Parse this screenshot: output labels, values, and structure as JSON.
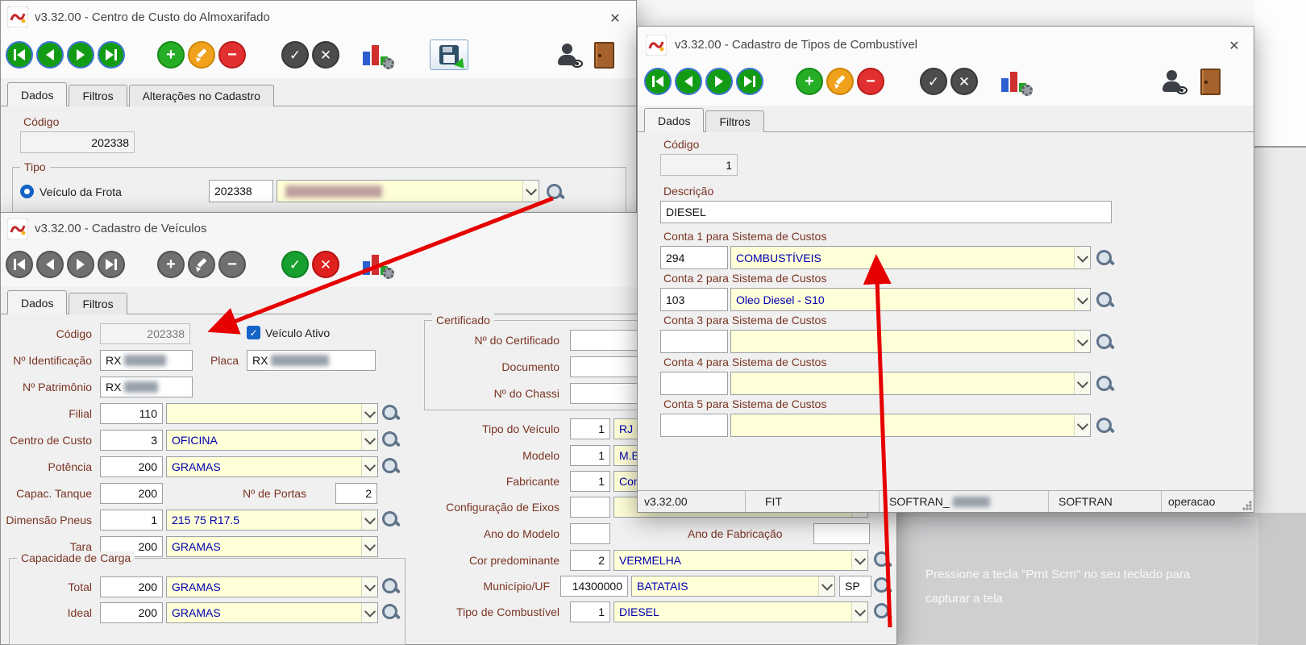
{
  "window_almoxarifado": {
    "title": "v3.32.00 - Centro de Custo do Almoxarifado",
    "tabs": {
      "dados": "Dados",
      "filtros": "Filtros",
      "alteracoes": "Alterações no Cadastro"
    },
    "codigo_label": "Código",
    "codigo_value": "202338",
    "tipo_group_label": "Tipo",
    "veiculo_frota_label": "Veículo da Frota",
    "veiculo_frota_code": "202338",
    "veiculo_frota_combo_value": ""
  },
  "window_veiculos": {
    "title": "v3.32.00 - Cadastro de Veículos",
    "tabs": {
      "dados": "Dados",
      "filtros": "Filtros"
    },
    "codigo_label": "Código",
    "codigo_value": "202338",
    "veiculo_ativo_label": "Veículo Ativo",
    "identificacao_label": "Nº Identificação",
    "identificacao_value": "RX",
    "placa_label": "Placa",
    "placa_value": "RX",
    "patrimonio_label": "Nº Patrimônio",
    "patrimonio_value": "RX",
    "filial": {
      "label": "Filial",
      "code": "110",
      "value": ""
    },
    "centro_custo": {
      "label": "Centro de Custo",
      "code": "3",
      "value": "OFICINA"
    },
    "potencia": {
      "label": "Potência",
      "code": "200",
      "value": "GRAMAS"
    },
    "capac_tanque": {
      "label": "Capac. Tanque",
      "code": "200"
    },
    "portas": {
      "label": "Nº de Portas",
      "value": "2"
    },
    "dimensao_pneus": {
      "label": "Dimensão Pneus",
      "code": "1",
      "value": "215 75 R17.5"
    },
    "tara": {
      "label": "Tara",
      "code": "200",
      "value": "GRAMAS"
    },
    "carga_group_label": "Capacidade de Carga",
    "carga_total": {
      "label": "Total",
      "code": "200",
      "value": "GRAMAS"
    },
    "carga_ideal": {
      "label": "Ideal",
      "code": "200",
      "value": "GRAMAS"
    },
    "certificado_group_label": "Certificado",
    "certificado_label": "Nº do Certificado",
    "documento_label": "Documento",
    "chassi_label": "Nº do Chassi",
    "tipo_veiculo": {
      "label": "Tipo do Veículo",
      "code": "1",
      "value": "RJ -"
    },
    "modelo": {
      "label": "Modelo",
      "code": "1",
      "value": "M.B"
    },
    "fabricante": {
      "label": "Fabricante",
      "code": "1",
      "value": "Con"
    },
    "config_eixos": {
      "label": "Configuração de Eixos",
      "code": "",
      "value": ""
    },
    "ano_modelo": {
      "label": "Ano do Modelo",
      "value": ""
    },
    "ano_fabricacao": {
      "label": "Ano de Fabricação",
      "value": ""
    },
    "cor": {
      "label": "Cor predominante",
      "code": "2",
      "value": "VERMELHA"
    },
    "municipio": {
      "label": "Município/UF",
      "code": "14300000",
      "value": "BATATAIS",
      "uf": "SP"
    },
    "tipo_combustivel": {
      "label": "Tipo de Combustível",
      "code": "1",
      "value": "DIESEL"
    }
  },
  "window_combustivel": {
    "title": "v3.32.00 - Cadastro de Tipos de Combustível",
    "tabs": {
      "dados": "Dados",
      "filtros": "Filtros"
    },
    "codigo_label": "Código",
    "codigo_value": "1",
    "descricao_label": "Descrição",
    "descricao_value": "DIESEL",
    "contas": [
      {
        "label": "Conta 1 para Sistema de Custos",
        "code": "294",
        "value": "COMBUSTÍVEIS"
      },
      {
        "label": "Conta 2 para Sistema de Custos",
        "code": "103",
        "value": "Oleo Diesel - S10"
      },
      {
        "label": "Conta 3 para Sistema de Custos",
        "code": "",
        "value": ""
      },
      {
        "label": "Conta 4 para Sistema de Custos",
        "code": "",
        "value": ""
      },
      {
        "label": "Conta 5 para Sistema de Custos",
        "code": "",
        "value": ""
      }
    ],
    "statusbar": {
      "version": "v3.32.00",
      "company": "FIT",
      "database": "SOFTRAN_",
      "system": "SOFTRAN",
      "user": "operacao"
    }
  },
  "screen_overlay": {
    "line1": "Pressione a tecla \"Prnt Scrn\" no seu teclado para",
    "line2": "capturar a tela"
  },
  "icons": {
    "navigate_first": "bar+left-triangle",
    "navigate_prev": "left-triangle",
    "navigate_next": "right-triangle",
    "navigate_last": "right-triangle+bar",
    "add": "+",
    "edit": "pencil",
    "delete": "−",
    "confirm": "✓",
    "cancel": "✕",
    "chart": "bar-chart-with-gear",
    "save": "disk-with-green-arrow",
    "user": "person-with-eye",
    "exit": "door",
    "search": "magnifier",
    "dropdown": "chevron-down",
    "close": "✕"
  },
  "colors": {
    "label_text": "#7a3422",
    "combo_bg": "#ffffd8",
    "combo_text": "#0000b0",
    "annotation_arrow": "#e60000",
    "selection_blue": "#1464c8"
  }
}
